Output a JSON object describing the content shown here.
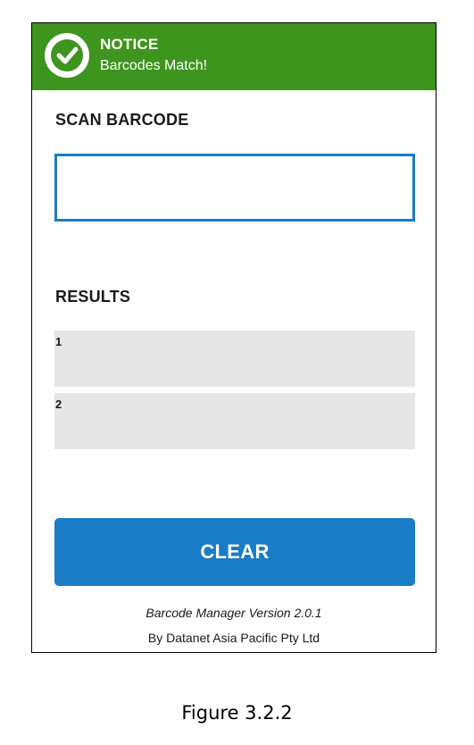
{
  "notice": {
    "title": "NOTICE",
    "message": "Barcodes Match!",
    "icon": "check-circle-icon",
    "color": "#3e951e"
  },
  "scan": {
    "heading": "SCAN BARCODE",
    "value": "",
    "placeholder": ""
  },
  "results": {
    "heading": "RESULTS",
    "items": [
      {
        "index": "1",
        "value": ""
      },
      {
        "index": "2",
        "value": ""
      }
    ]
  },
  "actions": {
    "clear_label": "CLEAR",
    "accent_color": "#1a7cc4"
  },
  "footer": {
    "version": "Barcode Manager Version 2.0.1",
    "company": "By Datanet Asia Pacific Pty Ltd"
  },
  "caption": "Figure 3.2.2"
}
